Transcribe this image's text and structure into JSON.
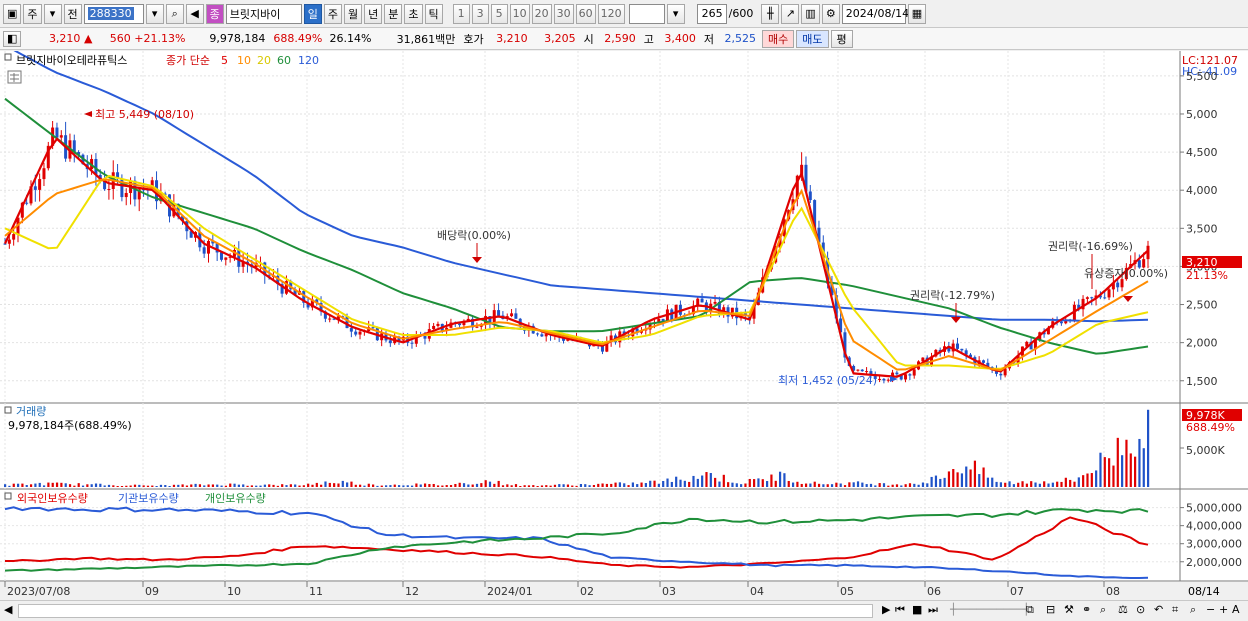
{
  "toolbar": {
    "period_type": "주",
    "prev_label": "전",
    "code": "288330",
    "stock_type_badge": "종",
    "stock_name": "브릿지바이",
    "tf_labels": [
      "일",
      "주",
      "월",
      "년",
      "분",
      "초",
      "틱"
    ],
    "active_tf": "일",
    "num_labels": [
      "1",
      "3",
      "5",
      "10",
      "20",
      "30",
      "60",
      "120"
    ],
    "count_value": "265",
    "count_total": "/600",
    "date": "2024/08/14"
  },
  "quote": {
    "price": "3,210",
    "arrow": "▲",
    "change": "560",
    "change_pct": "+21.13%",
    "volume": "9,978,184",
    "volume_ratio": "688.49%",
    "turnover": "26.14%",
    "trade_value": "31,861백만",
    "ask_label": "호가",
    "ask1": "3,210",
    "ask2": "3,205",
    "open_label": "시",
    "open": "2,590",
    "high_label": "고",
    "high": "3,400",
    "low_label": "저",
    "low": "2,525",
    "buy_label": "매수",
    "sell_label": "매도",
    "avg_label": "평"
  },
  "chart": {
    "name": "브릿지바이오테라퓨틱스",
    "ma_title": "종가 단순",
    "ma_periods": [
      "5",
      "10",
      "20",
      "60",
      "120"
    ],
    "ma_colors": {
      "5": "#e00000",
      "10": "#ff8c00",
      "20": "#f0e000",
      "60": "#1f8f3a",
      "120": "#2a5bd7"
    },
    "lc": "LC:121.07",
    "hc": "HC:-41.09",
    "price_ticks": [
      "5,500",
      "5,000",
      "4,500",
      "4,000",
      "3,500",
      "3,000",
      "2,500",
      "2,000",
      "1,500"
    ],
    "last_price": "3,210",
    "last_pct": "21.13%",
    "high_annot": "최고 5,449 (08/10)",
    "low_annot": "최저 1,452 (05/24)",
    "events": [
      "배당락(0.00%)",
      "권리락(-12.79%)",
      "권리락(-16.69%)",
      "유상증자(0.00%)"
    ],
    "volume_title": "거래량",
    "volume_value": "9,978,184주(688.49%)",
    "volume_last": "9,978K",
    "volume_pct": "688.49%",
    "volume_tick": "5,000K",
    "holders_titles": [
      "외국인보유수량",
      "기관보유수량",
      "개인보유수량"
    ],
    "holder_ticks": [
      "5,000,000",
      "4,000,000",
      "3,000,000",
      "2,000,000"
    ],
    "x_labels": [
      "2023/07/08",
      "09",
      "10",
      "11",
      "12",
      "2024/01",
      "02",
      "03",
      "04",
      "05",
      "06",
      "07",
      "08"
    ],
    "x_last": "08/14"
  },
  "chart_data": {
    "type": "line",
    "title": "브릿지바이오테라퓨틱스",
    "series": [
      {
        "name": "5",
        "values": [
          3300,
          4700,
          4100,
          4000,
          3300,
          3000,
          2550,
          2200,
          2000,
          2250,
          2350,
          2100,
          1950,
          2300,
          2500,
          2300,
          4300,
          1600,
          1550,
          1950,
          1600,
          2200,
          2600,
          3210
        ]
      },
      {
        "name": "20",
        "values": [
          3500,
          3200,
          4200,
          4050,
          3500,
          3100,
          2700,
          2300,
          2100,
          2100,
          2200,
          2150,
          2000,
          2100,
          2350,
          2400,
          3800,
          2500,
          1700,
          1700,
          1650,
          1850,
          2250,
          2400
        ]
      },
      {
        "name": "60",
        "values": [
          5200,
          4700,
          4200,
          3900,
          3700,
          3500,
          3200,
          2950,
          2650,
          2450,
          2200,
          2150,
          2150,
          2250,
          2350,
          2800,
          2850,
          2750,
          2600,
          2450,
          2200,
          2000,
          1850,
          1950
        ]
      },
      {
        "name": "120",
        "values": [
          5900,
          5550,
          5300,
          5000,
          4600,
          4200,
          3700,
          3400,
          3250,
          3050,
          2900,
          2750,
          2700,
          2650,
          2600,
          2550,
          2500,
          2450,
          2400,
          2350,
          2300,
          2300,
          2280,
          2300
        ]
      }
    ],
    "ylim": [
      1300,
      5800
    ],
    "volume": {
      "values": [
        0.3,
        0.5,
        0.4,
        0.3,
        0.2,
        0.3,
        0.4,
        0.3,
        0.3,
        0.8,
        0.3,
        0.4,
        0.3,
        0.9,
        0.2,
        0.3,
        0.4,
        0.5,
        0.9,
        2.0,
        0.6,
        1.7,
        0.5,
        0.6,
        0.4,
        0.7,
        3.5,
        0.6,
        0.8,
        1.0,
        4.8,
        9.9
      ],
      "unit": "K"
    },
    "holders": {
      "외국인보유수량": [
        2000000,
        2200000,
        2100000,
        2300000,
        2900000,
        2700000,
        2500000,
        2300000,
        1800000,
        1700000,
        1900000,
        2200000,
        3000000,
        2100000,
        4500000,
        2900000
      ],
      "기관보유수량": [
        5000000,
        4900000,
        4900000,
        4800000,
        4700000,
        3500000,
        3300000,
        3300000,
        2200000,
        2000000,
        1800000,
        1800000,
        1700000,
        1500000,
        1200000,
        1100000
      ],
      "개인보유수량": [
        1500000,
        1600000,
        1700000,
        1800000,
        1900000,
        2800000,
        3100000,
        3300000,
        3600000,
        4400000,
        4200000,
        4300000,
        4500000,
        4600000,
        4900000,
        4800000
      ]
    }
  }
}
